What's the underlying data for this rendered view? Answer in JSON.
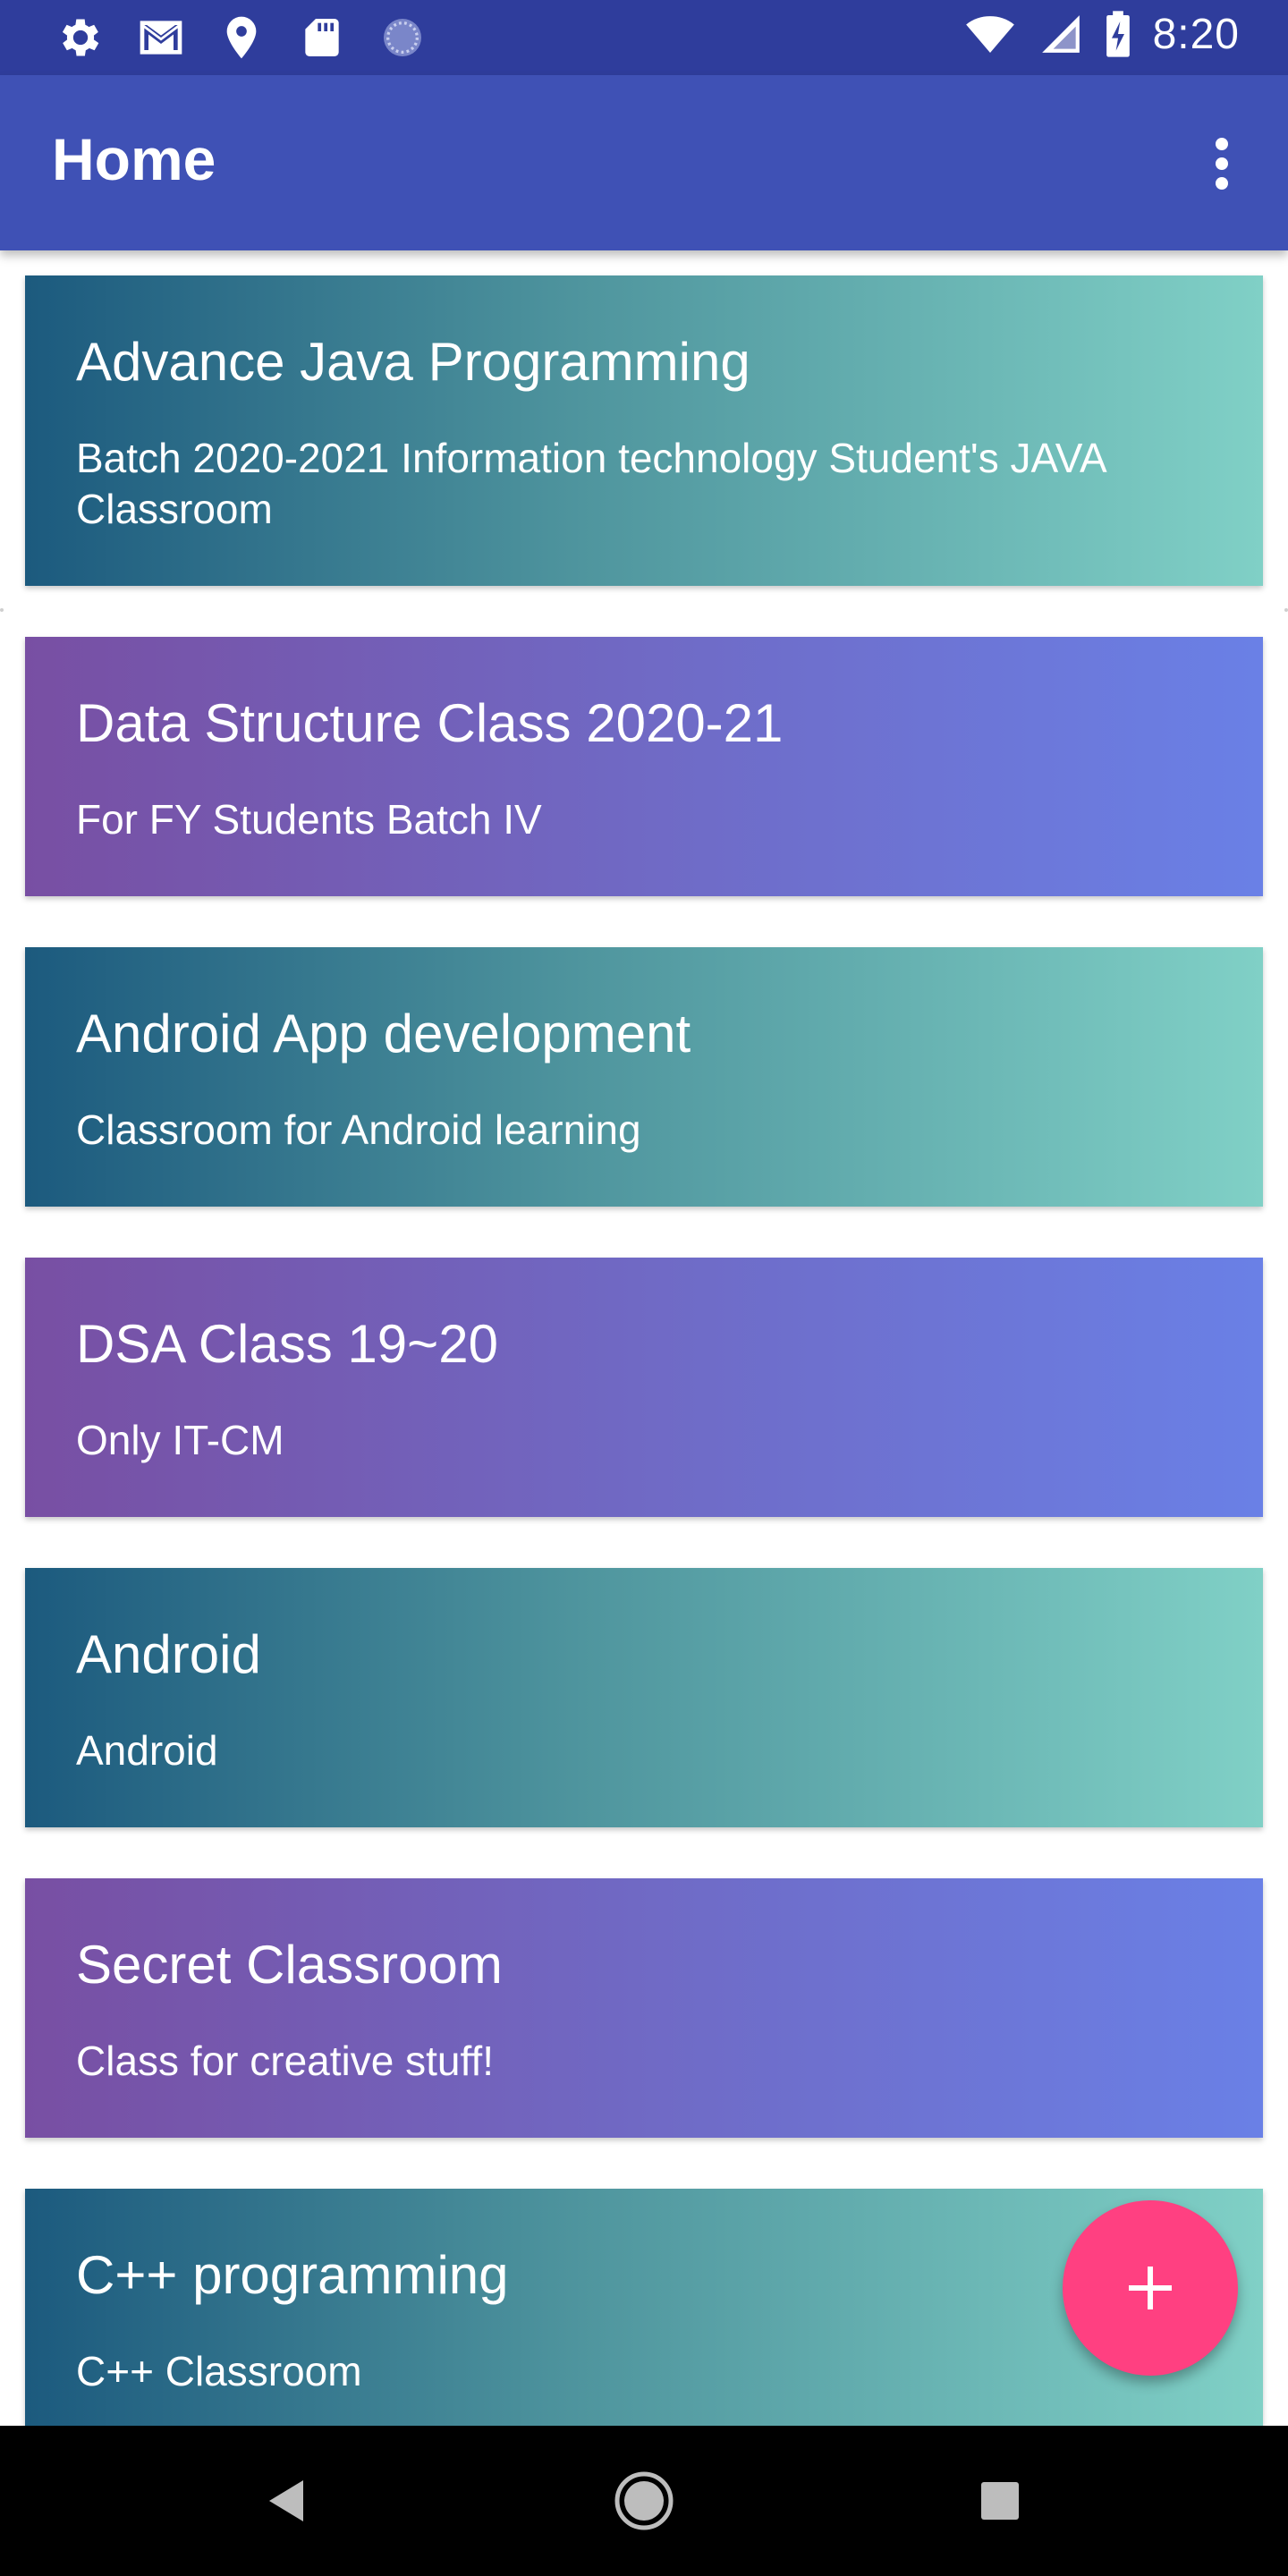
{
  "status_bar": {
    "time": "8:20",
    "left_icons": [
      "settings-icon",
      "gmail-icon",
      "location-icon",
      "sd-card-icon",
      "sync-icon"
    ],
    "right_icons": [
      "wifi-icon",
      "signal-icon",
      "battery-charging-icon"
    ]
  },
  "app_bar": {
    "title": "Home",
    "menu_icon": "more-vert-icon"
  },
  "classes": [
    {
      "title": "Advance Java Programming",
      "subtitle": "Batch 2020-2021 Information technology Student's JAVA Classroom",
      "style": "teal"
    },
    {
      "title": "Data Structure Class 2020-21",
      "subtitle": "For FY Students Batch IV",
      "style": "purple"
    },
    {
      "title": "Android App development",
      "subtitle": "Classroom for Android learning",
      "style": "teal"
    },
    {
      "title": "DSA Class 19~20",
      "subtitle": "Only IT-CM",
      "style": "purple"
    },
    {
      "title": "Android",
      "subtitle": "Android",
      "style": "teal"
    },
    {
      "title": "Secret Classroom",
      "subtitle": "Class for creative stuff!",
      "style": "purple"
    },
    {
      "title": "C++ programming",
      "subtitle": "C++ Classroom",
      "style": "teal"
    }
  ],
  "fab": {
    "icon": "plus-icon",
    "color": "#ff4081"
  },
  "nav_bar": {
    "icons": [
      "back-icon",
      "home-icon",
      "recents-icon"
    ]
  },
  "colors": {
    "status_bar": "#2f3d9c",
    "app_bar": "#3f51b5",
    "teal_start": "#1c5a7e",
    "teal_end": "#80d0c6",
    "purple_start": "#784fa3",
    "purple_end": "#6a80e6"
  }
}
